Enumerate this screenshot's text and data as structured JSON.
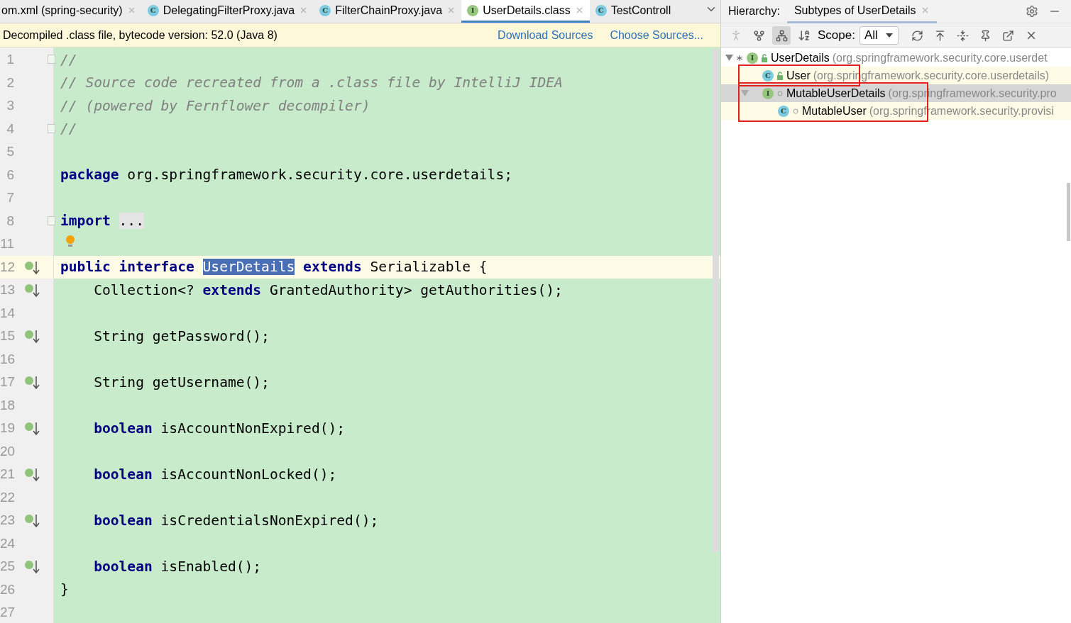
{
  "editor_tabs": [
    {
      "label": "om.xml (spring-security)",
      "selected": false,
      "closable": true
    },
    {
      "label": "DelegatingFilterProxy.java",
      "icon": "C",
      "selected": false,
      "closable": true
    },
    {
      "label": "FilterChainProxy.java",
      "icon": "C",
      "selected": false,
      "closable": true
    },
    {
      "label": "UserDetails.class",
      "icon": "I",
      "selected": true,
      "closable": true
    },
    {
      "label": "TestControll",
      "icon": "C",
      "selected": false,
      "closable": false
    }
  ],
  "notice_bar": {
    "text": "Decompiled .class file, bytecode version: 52.0 (Java 8)",
    "links": [
      "Download Sources",
      "Choose Sources..."
    ]
  },
  "code_lines": [
    {
      "number": "1",
      "fold": true,
      "marker": false,
      "current": false,
      "bulb": false,
      "tokens": [
        {
          "kind": "comment",
          "text": "//"
        }
      ]
    },
    {
      "number": "2",
      "fold": false,
      "marker": false,
      "current": false,
      "bulb": false,
      "tokens": [
        {
          "kind": "comment",
          "text": "// Source code recreated from a .class file by IntelliJ IDEA"
        }
      ]
    },
    {
      "number": "3",
      "fold": false,
      "marker": false,
      "current": false,
      "bulb": false,
      "tokens": [
        {
          "kind": "comment",
          "text": "// (powered by Fernflower decompiler)"
        }
      ]
    },
    {
      "number": "4",
      "fold": true,
      "marker": false,
      "current": false,
      "bulb": false,
      "tokens": [
        {
          "kind": "comment",
          "text": "//"
        }
      ]
    },
    {
      "number": "5",
      "fold": false,
      "marker": false,
      "current": false,
      "bulb": false
    },
    {
      "number": "6",
      "fold": false,
      "marker": false,
      "current": false,
      "bulb": false,
      "tokens": [
        {
          "kind": "keyword",
          "text": "package"
        },
        {
          "kind": "plain",
          "text": " org.springframework.security.core.userdetails;"
        }
      ]
    },
    {
      "number": "7",
      "fold": false,
      "marker": false,
      "current": false,
      "bulb": false
    },
    {
      "number": "8",
      "fold": true,
      "marker": false,
      "current": false,
      "bulb": false,
      "tokens": [
        {
          "kind": "keyword",
          "text": "import "
        },
        {
          "kind": "folded",
          "text": "..."
        }
      ]
    },
    {
      "number": "11",
      "fold": false,
      "marker": false,
      "current": false,
      "bulb": true
    },
    {
      "number": "12",
      "fold": false,
      "marker": true,
      "current": true,
      "bulb": false,
      "tokens": [
        {
          "kind": "keyword",
          "text": "public interface "
        },
        {
          "kind": "selected",
          "text": "UserDetails"
        },
        {
          "kind": "keyword",
          "text": " extends"
        },
        {
          "kind": "plain",
          "text": " Serializable {"
        }
      ]
    },
    {
      "number": "13",
      "fold": false,
      "marker": true,
      "current": false,
      "bulb": false,
      "tokens": [
        {
          "kind": "plain",
          "text": "    Collection<? "
        },
        {
          "kind": "keyword",
          "text": "extends"
        },
        {
          "kind": "plain",
          "text": " GrantedAuthority> getAuthorities();"
        }
      ]
    },
    {
      "number": "14",
      "fold": false,
      "marker": false,
      "current": false,
      "bulb": false
    },
    {
      "number": "15",
      "fold": false,
      "marker": true,
      "current": false,
      "bulb": false,
      "tokens": [
        {
          "kind": "plain",
          "text": "    String getPassword();"
        }
      ]
    },
    {
      "number": "16",
      "fold": false,
      "marker": false,
      "current": false,
      "bulb": false
    },
    {
      "number": "17",
      "fold": false,
      "marker": true,
      "current": false,
      "bulb": false,
      "tokens": [
        {
          "kind": "plain",
          "text": "    String getUsername();"
        }
      ]
    },
    {
      "number": "18",
      "fold": false,
      "marker": false,
      "current": false,
      "bulb": false
    },
    {
      "number": "19",
      "fold": false,
      "marker": true,
      "current": false,
      "bulb": false,
      "tokens": [
        {
          "kind": "keyword",
          "text": "    boolean"
        },
        {
          "kind": "plain",
          "text": " isAccountNonExpired();"
        }
      ]
    },
    {
      "number": "20",
      "fold": false,
      "marker": false,
      "current": false,
      "bulb": false
    },
    {
      "number": "21",
      "fold": false,
      "marker": true,
      "current": false,
      "bulb": false,
      "tokens": [
        {
          "kind": "keyword",
          "text": "    boolean"
        },
        {
          "kind": "plain",
          "text": " isAccountNonLocked();"
        }
      ]
    },
    {
      "number": "22",
      "fold": false,
      "marker": false,
      "current": false,
      "bulb": false
    },
    {
      "number": "23",
      "fold": false,
      "marker": true,
      "current": false,
      "bulb": false,
      "tokens": [
        {
          "kind": "keyword",
          "text": "    boolean"
        },
        {
          "kind": "plain",
          "text": " isCredentialsNonExpired();"
        }
      ]
    },
    {
      "number": "24",
      "fold": false,
      "marker": false,
      "current": false,
      "bulb": false
    },
    {
      "number": "25",
      "fold": false,
      "marker": true,
      "current": false,
      "bulb": false,
      "tokens": [
        {
          "kind": "keyword",
          "text": "    boolean"
        },
        {
          "kind": "plain",
          "text": " isEnabled();"
        }
      ]
    },
    {
      "number": "26",
      "fold": false,
      "marker": false,
      "current": false,
      "bulb": false,
      "tokens": [
        {
          "kind": "plain",
          "text": "}"
        }
      ]
    },
    {
      "number": "27",
      "fold": false,
      "marker": false,
      "current": false,
      "bulb": false
    }
  ],
  "hierarchy": {
    "label": "Hierarchy:",
    "tab": "Subtypes of UserDetails",
    "scope_label": "Scope:",
    "scope_value": "All",
    "tree": [
      {
        "name": "UserDetails",
        "package": "(org.springframework.security.core.userdet",
        "icon": "I",
        "unlocked": true,
        "star": true,
        "selected": false,
        "highlighted": false,
        "framed": false,
        "expanded": true,
        "children": [
          {
            "name": "User",
            "package": "(org.springframework.security.core.userdetails)",
            "icon": "C",
            "unlocked": true,
            "star": false,
            "selected": false,
            "highlighted": true,
            "framed": true
          },
          {
            "name": "MutableUserDetails",
            "package": "(org.springframework.security.pro",
            "icon": "I",
            "unlocked": false,
            "star": false,
            "selected": true,
            "highlighted": false,
            "framed": true,
            "expanded": true,
            "children": [
              {
                "name": "MutableUser",
                "package": "(org.springframework.security.provisi",
                "icon": "C",
                "unlocked": false,
                "star": false,
                "selected": false,
                "highlighted": true,
                "framed": true
              }
            ]
          }
        ]
      }
    ]
  }
}
